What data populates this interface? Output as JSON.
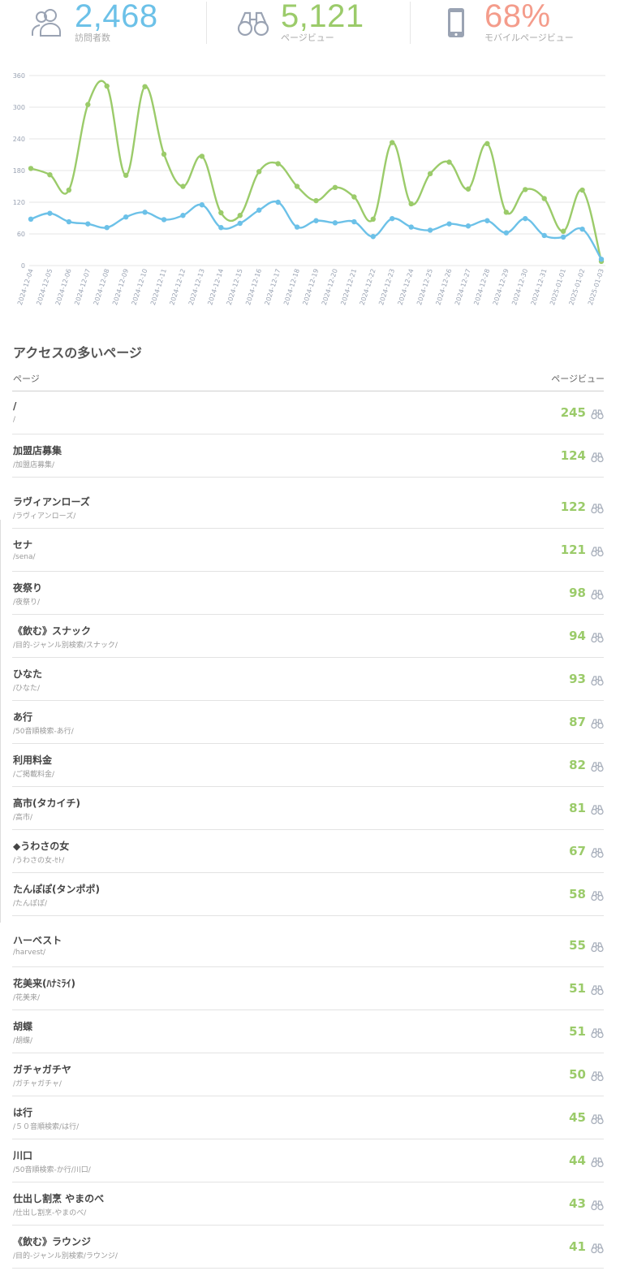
{
  "stats": [
    {
      "value": "2,468",
      "label": "訪問者数",
      "color": "#6cc1e8",
      "icon": "users-icon"
    },
    {
      "value": "5,121",
      "label": "ページビュー",
      "color": "#9bcb6a",
      "icon": "binoculars-icon"
    },
    {
      "value": "68%",
      "label": "モバイルページビュー",
      "color": "#f49c8b",
      "icon": "mobile-phone-icon"
    }
  ],
  "chart_data": {
    "type": "line",
    "categories": [
      "2024-12-04",
      "2024-12-05",
      "2024-12-06",
      "2024-12-07",
      "2024-12-08",
      "2024-12-09",
      "2024-12-10",
      "2024-12-11",
      "2024-12-12",
      "2024-12-13",
      "2024-12-14",
      "2024-12-15",
      "2024-12-16",
      "2024-12-17",
      "2024-12-18",
      "2024-12-19",
      "2024-12-20",
      "2024-12-21",
      "2024-12-22",
      "2024-12-23",
      "2024-12-24",
      "2024-12-25",
      "2024-12-26",
      "2024-12-27",
      "2024-12-28",
      "2024-12-29",
      "2024-12-30",
      "2024-12-31",
      "2025-01-01",
      "2025-01-02",
      "2025-01-03"
    ],
    "series": [
      {
        "color": "#9bcb6a",
        "values": [
          184,
          172,
          143,
          305,
          340,
          171,
          339,
          211,
          150,
          207,
          100,
          95,
          178,
          193,
          150,
          123,
          148,
          130,
          88,
          233,
          117,
          174,
          196,
          145,
          231,
          101,
          144,
          127,
          65,
          143,
          8
        ]
      },
      {
        "color": "#6cc1e8",
        "values": [
          88,
          99,
          83,
          79,
          72,
          92,
          101,
          87,
          95,
          115,
          72,
          80,
          105,
          120,
          73,
          85,
          81,
          83,
          55,
          89,
          73,
          67,
          79,
          75,
          85,
          62,
          89,
          57,
          54,
          69,
          12
        ]
      }
    ],
    "yticks": [
      0,
      60,
      120,
      180,
      240,
      300,
      360
    ],
    "ylim": [
      0,
      360
    ],
    "grid": true
  },
  "top_pages": {
    "title": "アクセスの多いページ",
    "col_page": "ページ",
    "col_pv": "ページビュー",
    "rows": [
      {
        "title": "/",
        "path": "/",
        "pv": "245"
      },
      {
        "title": "加盟店募集",
        "path": "/加盟店募集/",
        "pv": "124"
      },
      {
        "title": "ラヴィアンローズ",
        "path": "/ラヴィアンローズ/",
        "pv": "122"
      },
      {
        "title": "セナ",
        "path": "/sena/",
        "pv": "121"
      },
      {
        "title": "夜祭り",
        "path": "/夜祭り/",
        "pv": "98"
      },
      {
        "title": "《飲む》スナック",
        "path": "/目的-ジャンル別検索/スナック/",
        "pv": "94"
      },
      {
        "title": "ひなた",
        "path": "/ひなた/",
        "pv": "93"
      },
      {
        "title": "あ行",
        "path": "/50音順検索-あ行/",
        "pv": "87"
      },
      {
        "title": "利用料金",
        "path": "/ご掲載料金/",
        "pv": "82"
      },
      {
        "title": "高市(タカイチ)",
        "path": "/高市/",
        "pv": "81"
      },
      {
        "title": "◆うわさの女",
        "path": "/うわさの女-ｾﾄ/",
        "pv": "67"
      },
      {
        "title": "たんぽぽ(タンポポ)",
        "path": "/たんぽぽ/",
        "pv": "58"
      },
      {
        "title": "ハーベスト",
        "path": "/harvest/",
        "pv": "55"
      },
      {
        "title": "花美来(ﾊﾅﾐﾗｲ)",
        "path": "/花美来/",
        "pv": "51"
      },
      {
        "title": "胡蝶",
        "path": "/胡蝶/",
        "pv": "51"
      },
      {
        "title": "ガチャガチヤ",
        "path": "/ガチャガチャ/",
        "pv": "50"
      },
      {
        "title": "は行",
        "path": "/５０音順検索/は行/",
        "pv": "45"
      },
      {
        "title": "川口",
        "path": "/50音順検索-か行/川口/",
        "pv": "44"
      },
      {
        "title": "仕出し割烹 やまのべ",
        "path": "/仕出し割烹-やまのべ/",
        "pv": "43"
      },
      {
        "title": "《飲む》ラウンジ",
        "path": "/目的-ジャンル別検索/ラウンジ/",
        "pv": "41"
      }
    ]
  }
}
